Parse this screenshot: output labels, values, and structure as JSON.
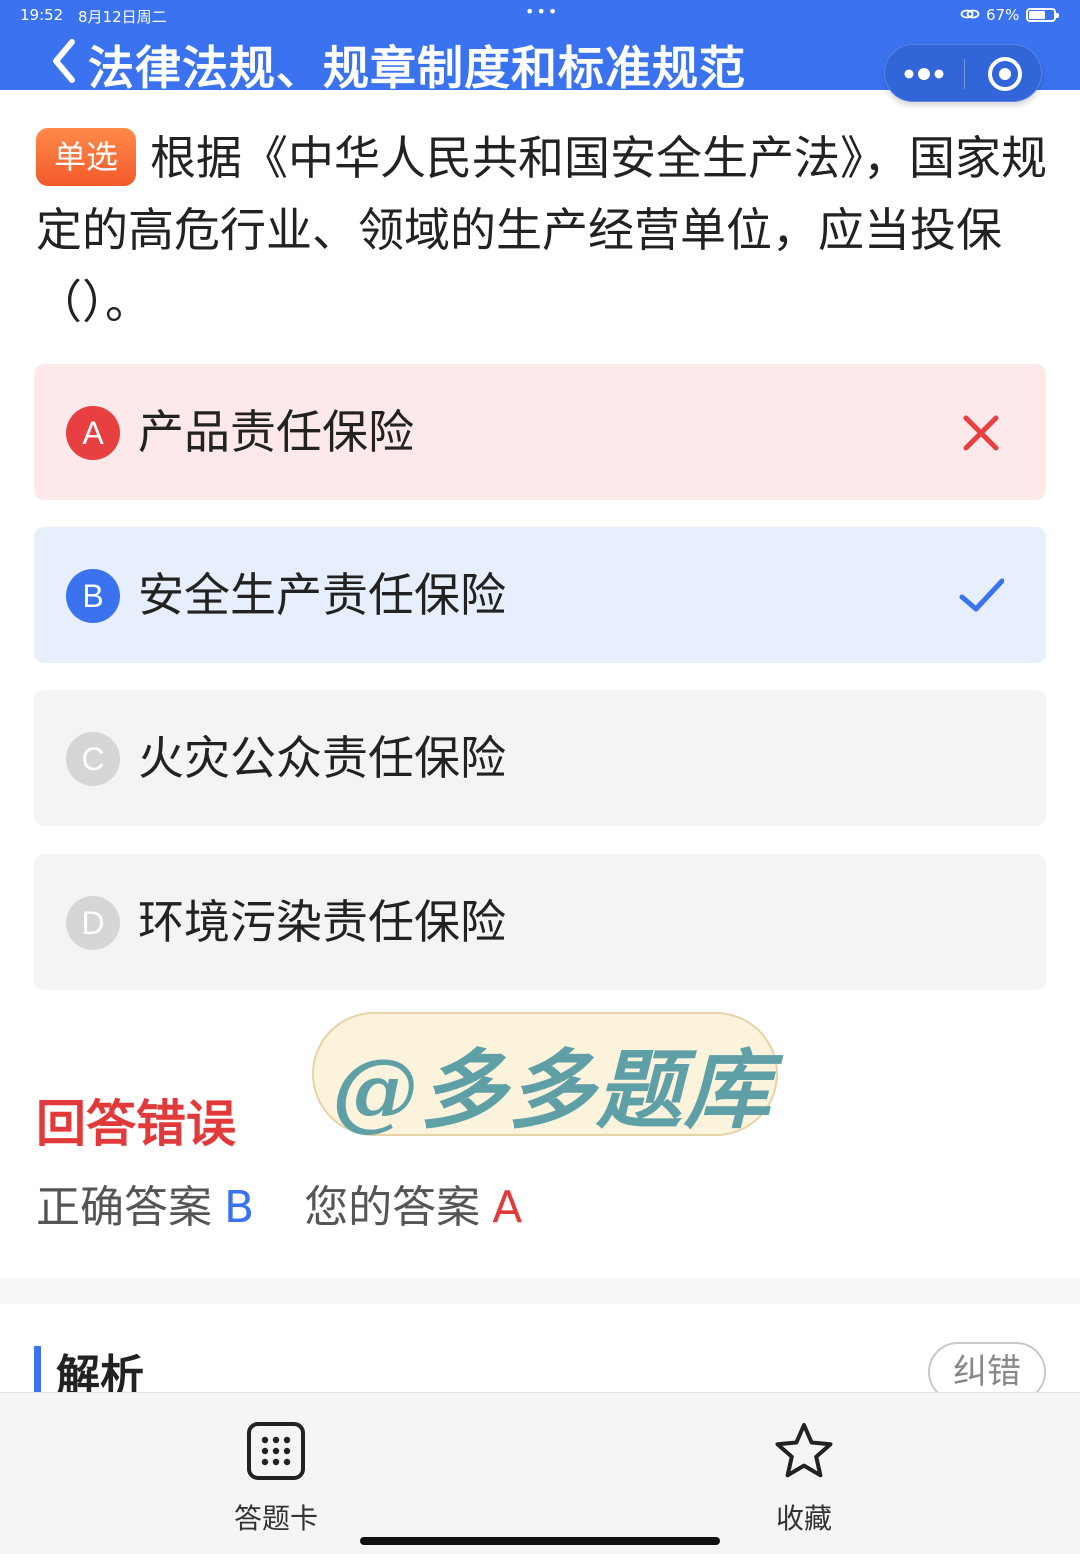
{
  "status_bar": {
    "time": "19:52",
    "date": "8月12日周二",
    "battery": "67%",
    "battery_level": 0.67
  },
  "header": {
    "title": "法律法规、规章制度和标准规范"
  },
  "question": {
    "type_tag": "单选",
    "text": "根据《中华人民共和国安全生产法》，国家规定的高危行业、领域的生产经营单位，应当投保（）。"
  },
  "options": [
    {
      "letter": "A",
      "text": "产品责任保险",
      "state": "wrong"
    },
    {
      "letter": "B",
      "text": "安全生产责任保险",
      "state": "correct"
    },
    {
      "letter": "C",
      "text": "火灾公众责任保险",
      "state": "none"
    },
    {
      "letter": "D",
      "text": "环境污染责任保险",
      "state": "none"
    }
  ],
  "watermark": "@多多题库",
  "result": {
    "title": "回答错误",
    "correct_label": "正确答案",
    "correct_value": "B",
    "yours_label": "您的答案",
    "yours_value": "A"
  },
  "analysis": {
    "title": "解析",
    "report_button": "纠错"
  },
  "bottom_bar": {
    "answer_card": "答题卡",
    "favorite": "收藏"
  },
  "colors": {
    "primary": "#3a72f0",
    "error": "#e23a3a",
    "tag": "#f25a2a"
  },
  "icons": {
    "back": "chevron-left-icon",
    "more": "more-dots-icon",
    "close": "target-circle-icon",
    "wrong": "cross-icon",
    "right": "check-icon",
    "answer_card": "grid-dots-icon",
    "favorite": "star-icon"
  }
}
